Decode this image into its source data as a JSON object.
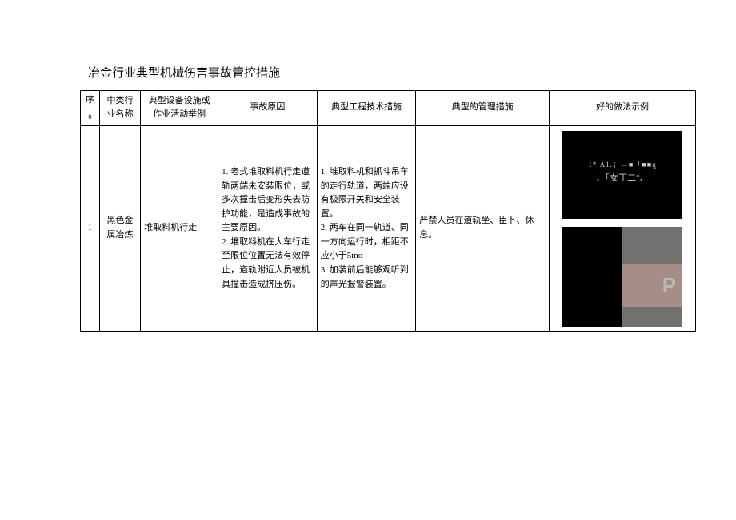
{
  "title": "冶金行业典型机械伤害事故管控措施",
  "headers": {
    "seq": "序",
    "seq_sub": "0",
    "industry": "中类行业名称",
    "equipment": "典型设备设施或作业活动举例",
    "reason": "事故原因",
    "engineering": "典型工程技术措施",
    "management": "典型的管理措施",
    "example": "好的做法示例"
  },
  "rows": [
    {
      "seq": "1",
      "industry": "黑色金属冶炼",
      "equipment": "堆取料机行走",
      "reason": "1. 老式堆取料机行走道轨两端未安装限位，或多次撞击后变形失去防护功能，是造成事故的主要原因。\n2. 堆取料机在大车行走至限位位置无法有效停止，道轨附近人员被机具撞击造成挤压伤。",
      "engineering": "1. 堆取料机和抓斗吊车的走行轨道，两端应设有极限开关和安全装置。\n2. 两车在同一轨道、同一方向运行时，相距不应小于5mo\n3. 加装前后能够观听到的声光报警装置。",
      "management": "严禁人员在道轨坐、臣卜、休息。",
      "img1_line1": "1*.A1.；→■「■■q",
      "img1_line2": "、「女丁二°、",
      "img2_letter": "P"
    }
  ]
}
